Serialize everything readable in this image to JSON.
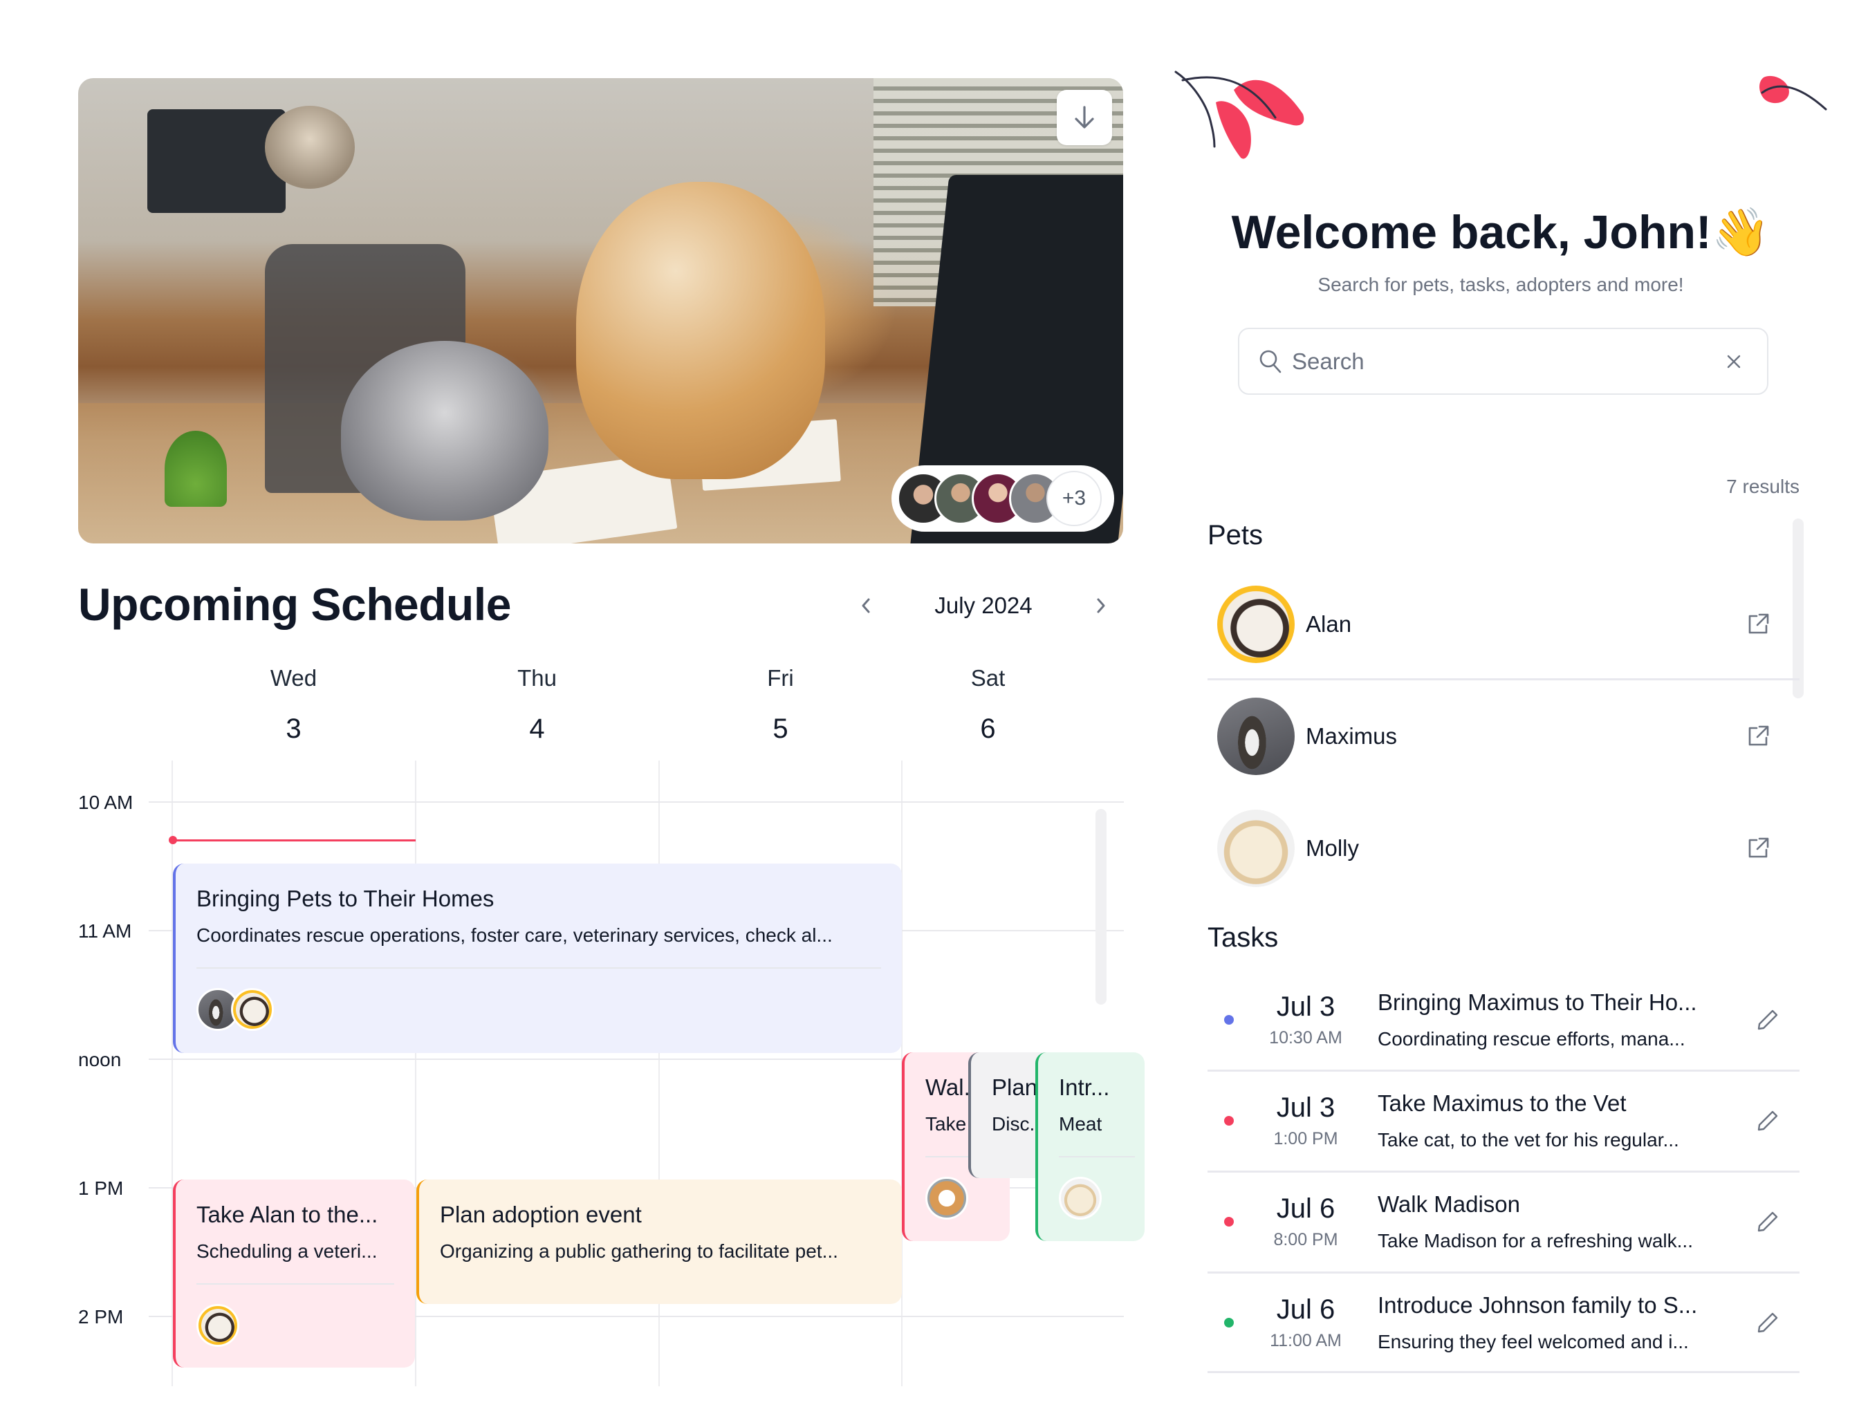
{
  "hero": {
    "image_alt": "Cat and dog working at office desks",
    "download_icon": "arrow-down-icon",
    "team_avatars": [
      "person-avatar",
      "person-avatar",
      "person-avatar",
      "person-avatar"
    ],
    "more_count": "+3"
  },
  "schedule": {
    "title": "Upcoming Schedule",
    "month": "July 2024",
    "prev_icon": "chevron-left-icon",
    "next_icon": "chevron-right-icon",
    "days": [
      {
        "name": "Wed",
        "num": "3"
      },
      {
        "name": "Thu",
        "num": "4"
      },
      {
        "name": "Fri",
        "num": "5"
      },
      {
        "name": "Sat",
        "num": "6"
      }
    ],
    "hours": [
      "10 AM",
      "11 AM",
      "noon",
      "1 PM",
      "2 PM"
    ],
    "events": [
      {
        "title": "Bringing Pets to Their Homes",
        "desc": "Coordinates rescue operations, foster care, veterinary services, check al...",
        "color": "#6373e8"
      },
      {
        "title": "Take Alan to the...",
        "desc": "Scheduling a veteri...",
        "color": "#f43f5e"
      },
      {
        "title": "Plan adoption event",
        "desc": "Organizing a public gathering to facilitate pet...",
        "color": "#f59e0b"
      },
      {
        "title": "Wal...",
        "desc": "Take",
        "color": "#f43f5e"
      },
      {
        "title": "Plan",
        "desc": "Disc...",
        "color": "#6b7280"
      },
      {
        "title": "Intr...",
        "desc": "Meat",
        "color": "#22b56a"
      }
    ]
  },
  "panel": {
    "welcome": "Welcome back, John!",
    "wave_emoji": "👋",
    "subtitle": "Search for pets, tasks, adopters and more!",
    "search_placeholder": "Search",
    "search_value": "",
    "results": "7 results",
    "pets_heading": "Pets",
    "pets": [
      {
        "name": "Alan"
      },
      {
        "name": "Maximus"
      },
      {
        "name": "Molly"
      }
    ],
    "tasks_heading": "Tasks",
    "tasks": [
      {
        "day": "Jul 3",
        "time": "10:30 AM",
        "title": "Bringing Maximus to Their Ho...",
        "desc": "Coordinating rescue efforts, mana...",
        "color": "#6373e8"
      },
      {
        "day": "Jul 3",
        "time": "1:00 PM",
        "title": "Take Maximus to the Vet",
        "desc": "Take cat, to the vet for his regular...",
        "color": "#f43f5e"
      },
      {
        "day": "Jul 6",
        "time": "8:00 PM",
        "title": "Walk Madison",
        "desc": "Take Madison for a refreshing walk...",
        "color": "#f43f5e"
      },
      {
        "day": "Jul 6",
        "time": "11:00 AM",
        "title": "Introduce Johnson family to S...",
        "desc": "Ensuring they feel welcomed and i...",
        "color": "#22b56a"
      }
    ]
  },
  "colors": {
    "accent_red": "#f43f5e",
    "accent_blue": "#6373e8",
    "accent_green": "#22b56a",
    "accent_orange": "#f59e0b",
    "text_primary": "#111827",
    "text_muted": "#6b7280"
  }
}
